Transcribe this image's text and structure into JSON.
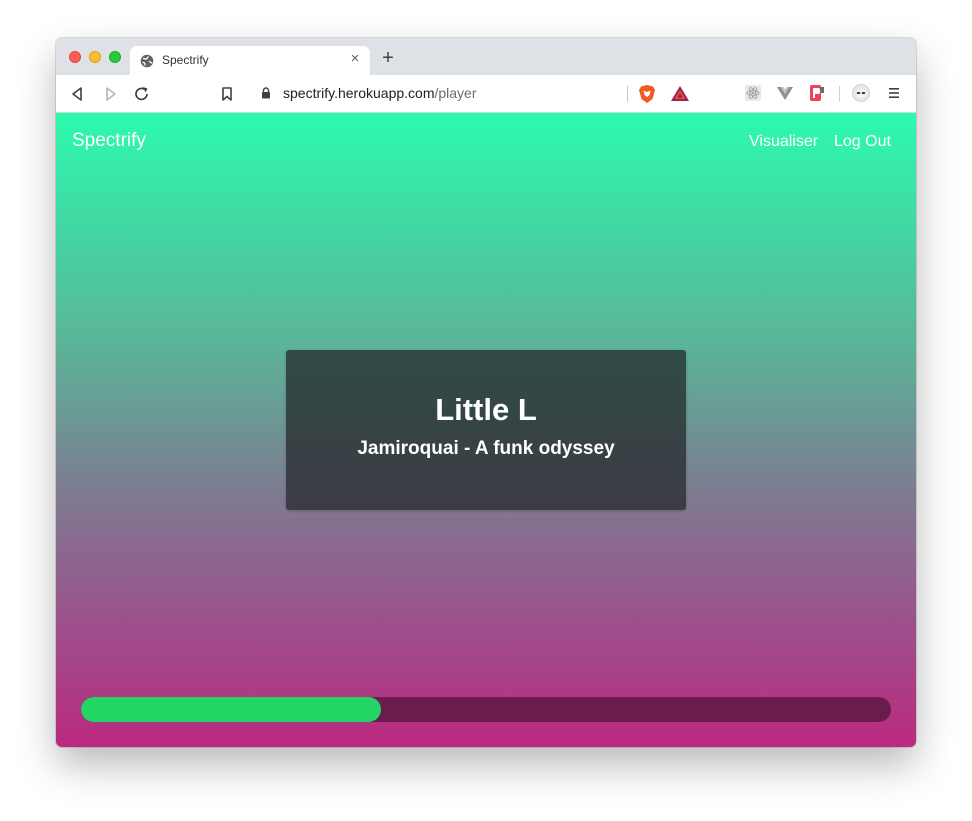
{
  "browser": {
    "tab_title": "Spectrify",
    "tab_close": "×",
    "new_tab": "+",
    "url_host": "spectrify.herokuapp.com",
    "url_path": "/player"
  },
  "nav": {
    "brand": "Spectrify",
    "visualiser": "Visualiser",
    "logout": "Log Out"
  },
  "player": {
    "track_title": "Little L",
    "track_subtitle": "Jamiroquai - A funk odyssey",
    "progress_fraction": 0.37
  },
  "colors": {
    "gradient_top": "#2cfaae",
    "gradient_bottom": "#bb2a7f",
    "progress_fill": "#23d664",
    "progress_track": "#6a1d4c"
  }
}
